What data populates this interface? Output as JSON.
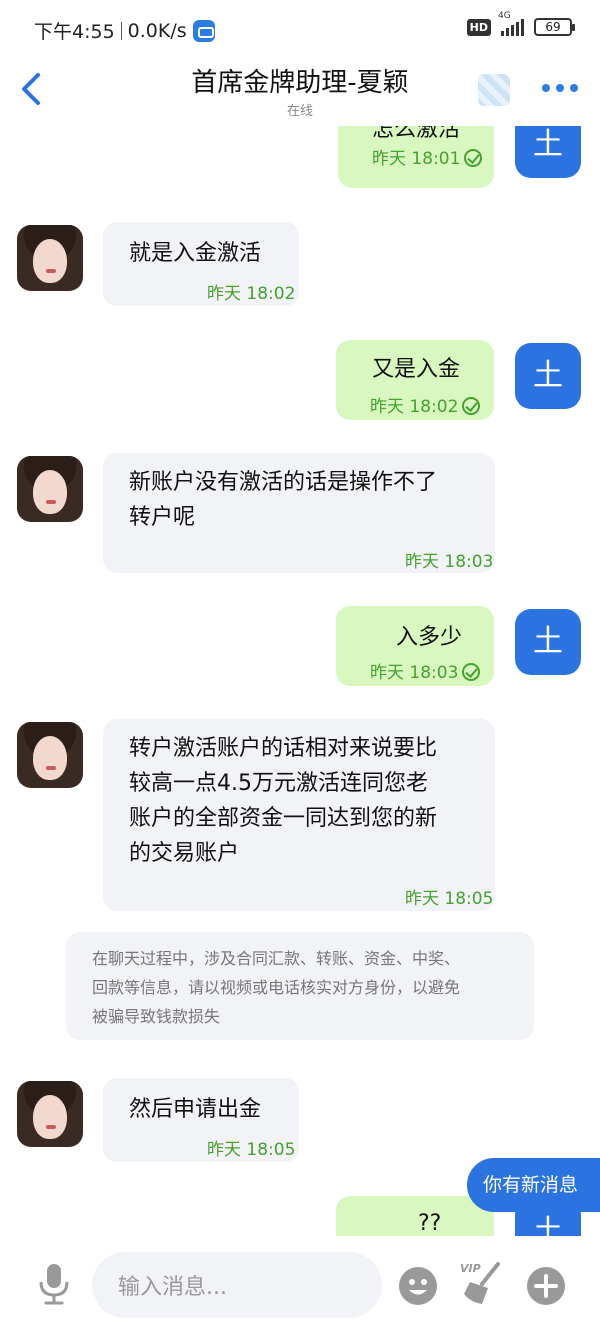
{
  "status_bar": {
    "time": "下午4:55",
    "speed": "0.0K/s",
    "hd": "HD",
    "network": "4G",
    "battery": "69"
  },
  "header": {
    "title": "首席金牌助理-夏颖",
    "subtitle": "在线"
  },
  "messages": [
    {
      "side": "out",
      "text": "怎么激活",
      "time": "昨天 18:01"
    },
    {
      "side": "in",
      "text": "就是入金激活",
      "time": "昨天 18:02"
    },
    {
      "side": "out",
      "text": "又是入金",
      "time": "昨天 18:02"
    },
    {
      "side": "in",
      "text_lines": [
        "新账户没有激活的话是操作不了",
        "转户呢"
      ],
      "time": "昨天 18:03"
    },
    {
      "side": "out",
      "text": "入多少",
      "time": "昨天 18:03"
    },
    {
      "side": "in",
      "text_lines": [
        "转户激活账户的话相对来说要比",
        "较高一点4.5万元激活连同您老",
        "账户的全部资金一同达到您的新",
        "的交易账户"
      ],
      "time": "昨天 18:05"
    },
    {
      "side": "in",
      "text": "然后申请出金",
      "time": "昨天 18:05"
    },
    {
      "side": "out",
      "text": "??"
    }
  ],
  "notice": {
    "lines": [
      "在聊天过程中，涉及合同汇款、转账、资金、中奖、",
      "回款等信息，请以视频或电话核实对方身份，以避免",
      "被骗导致钱款损失"
    ]
  },
  "self_avatar_glyph": "土",
  "new_message_label": "你有新消息",
  "input": {
    "placeholder": "输入消息..."
  },
  "icons": {
    "back": "back-arrow-icon",
    "more": "more-dots-icon",
    "mic": "microphone-icon",
    "emoji": "emoji-icon",
    "vip_sticker": "vip-broom-icon",
    "plus": "plus-icon"
  },
  "colors": {
    "accent": "#2a73e0",
    "outgoing_bubble": "#d8f8c0",
    "incoming_bubble": "#f2f3f6",
    "timestamp": "#45a22f"
  }
}
